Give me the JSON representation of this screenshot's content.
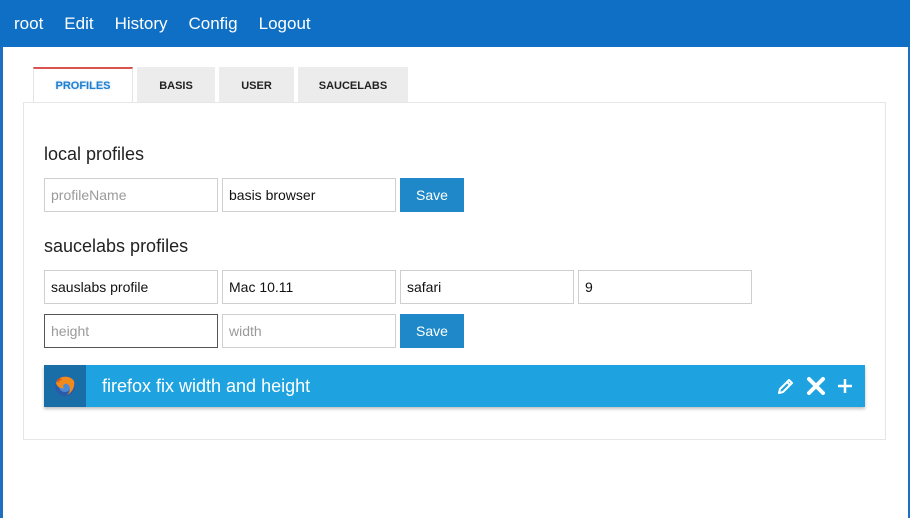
{
  "navbar": {
    "items": [
      "root",
      "Edit",
      "History",
      "Config",
      "Logout"
    ]
  },
  "tabs": [
    {
      "label": "PROFILES",
      "active": true
    },
    {
      "label": "BASIS",
      "active": false
    },
    {
      "label": "USER",
      "active": false
    },
    {
      "label": "SAUCELABS",
      "active": false
    }
  ],
  "local": {
    "title": "local profiles",
    "name_placeholder": "profileName",
    "browser_value": "basis browser",
    "save_label": "Save"
  },
  "saucelabs": {
    "title": "saucelabs profiles",
    "profile_value": "sauslabs profile",
    "os_value": "Mac 10.11",
    "browser_value": "safari",
    "version_value": "9",
    "height_placeholder": "height",
    "width_placeholder": "width",
    "save_label": "Save"
  },
  "profile_list": [
    {
      "name": "firefox fix width and height",
      "icon": "firefox-icon"
    }
  ],
  "profile_actions": [
    "edit-icon",
    "delete-icon",
    "add-icon"
  ],
  "colors": {
    "navbar": "#0e6fc4",
    "accent": "#1e88c8",
    "profile_bar": "#1ea3e0",
    "active_tab_top": "#d9534f"
  }
}
